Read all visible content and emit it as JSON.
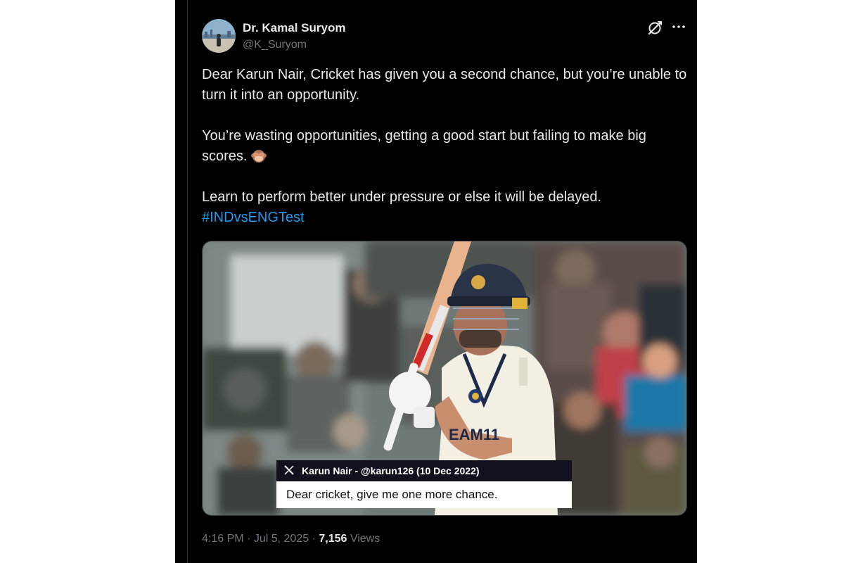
{
  "author": {
    "display_name": "Dr. Kamal Suryom",
    "handle": "@K_Suryom"
  },
  "icons": [
    "grok-icon",
    "more-icon",
    "see-no-evil-monkey-emoji",
    "x-logo-icon"
  ],
  "tweet": {
    "paragraph_1": "Dear Karun Nair, Cricket has given you a second chance, but you’re unable to turn it into an opportunity.",
    "paragraph_2": "You’re wasting opportunities, getting a good start but failing to make big scores.",
    "paragraph_3": "Learn to perform better under pressure or else it will be delayed.",
    "hashtag": "#INDvsENGTest"
  },
  "media": {
    "sponsor_text": "EAM11",
    "quoted_author": "Karun Nair - @karun126  (10 Dec 2022)",
    "quoted_text": "Dear cricket, give me one more chance."
  },
  "meta": {
    "time": "4:16 PM",
    "separator": "·",
    "date": "Jul 5, 2025",
    "views_count": "7,156",
    "views_label": "Views"
  },
  "colors": {
    "background": "#000000",
    "text": "#e7e9ea",
    "muted": "#71767b",
    "link": "#1d9bf0"
  }
}
